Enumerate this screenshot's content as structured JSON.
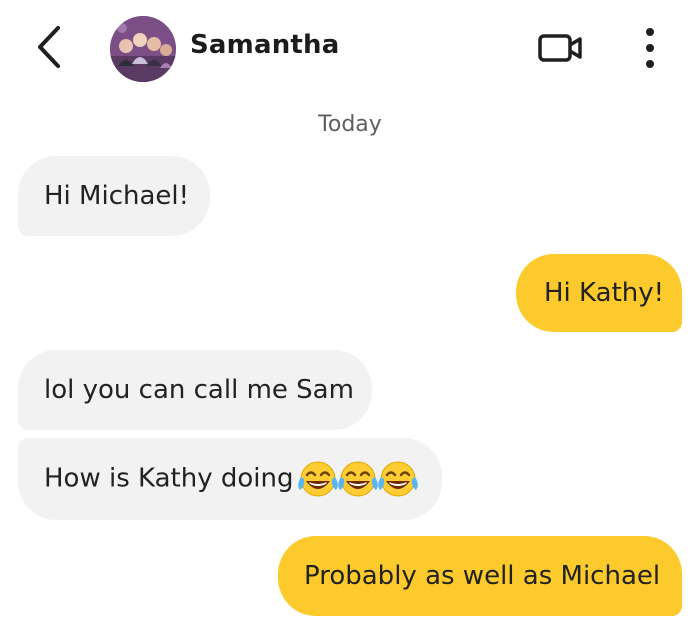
{
  "header": {
    "contact_name": "Samantha",
    "back_icon": "chevron-left-icon",
    "video_icon": "video-call-icon",
    "more_icon": "more-vertical-icon"
  },
  "conversation": {
    "date_separator": "Today",
    "messages": [
      {
        "direction": "incoming",
        "text": "Hi Michael!"
      },
      {
        "direction": "outgoing",
        "text": "Hi Kathy!"
      },
      {
        "direction": "incoming",
        "text": "lol you can call me Sam"
      },
      {
        "direction": "incoming",
        "text": "How is Kathy doing",
        "emoji": "face-with-tears-of-joy x3"
      },
      {
        "direction": "outgoing",
        "text": "Probably as well as Michael"
      }
    ]
  },
  "colors": {
    "outgoing_bubble": "#fcca2c",
    "incoming_bubble": "#f2f2f2",
    "background": "#ffffff"
  }
}
